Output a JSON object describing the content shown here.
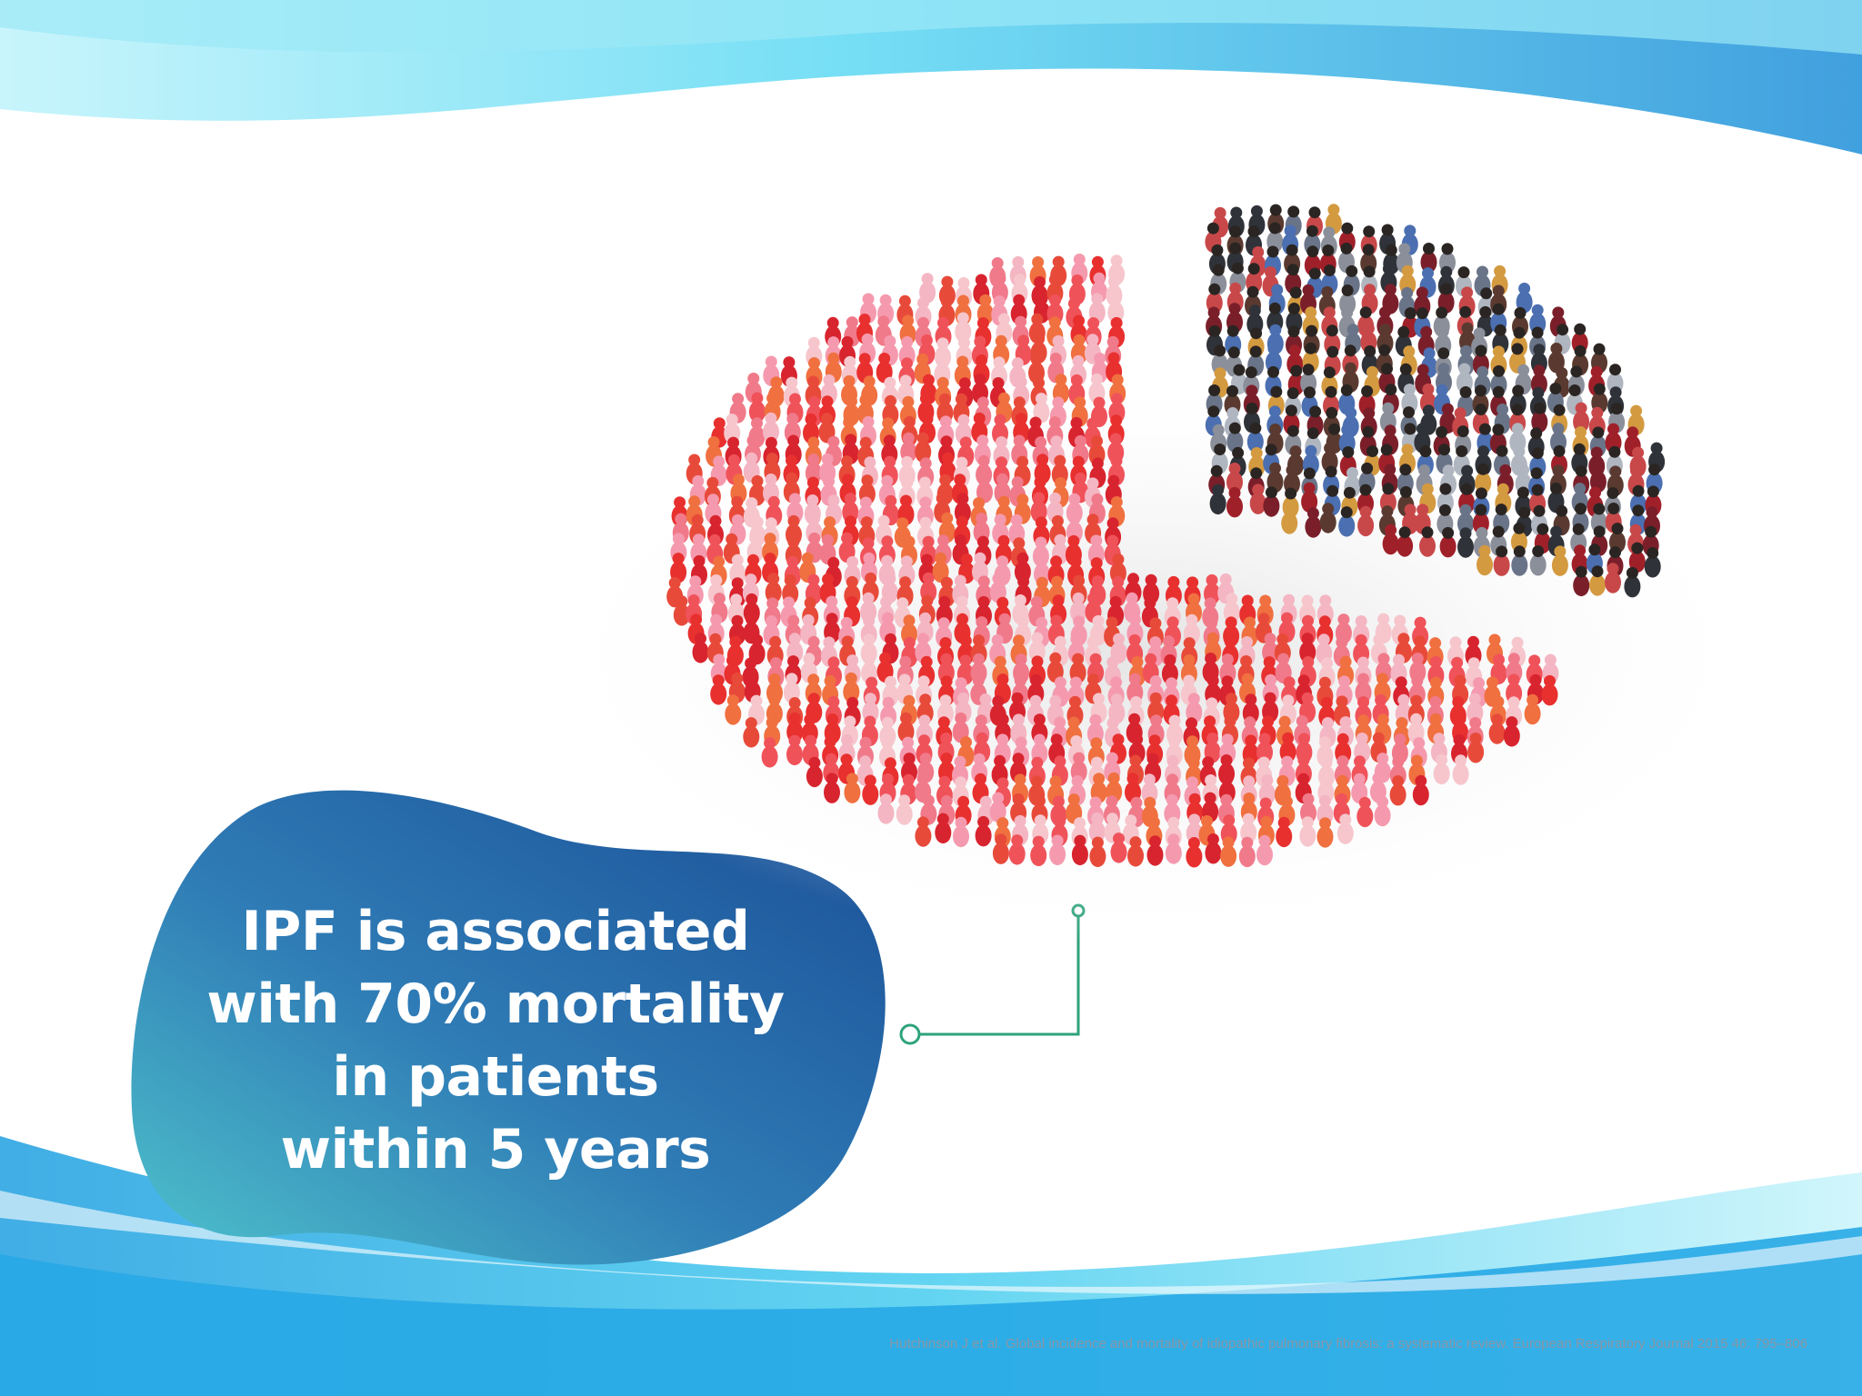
{
  "colors": {
    "wave_cyan": "#3fd0f0",
    "wave_blue": "#1f8fd8",
    "blob_dark": "#1a4e96",
    "blob_light": "#3fb6c6",
    "connector": "#2ea37a",
    "red_people": [
      "#e8302f",
      "#f0525a",
      "#f07a8a",
      "#f59aae",
      "#f4b6c2",
      "#e84a3a",
      "#f07040",
      "#d8242e",
      "#f6c6cc"
    ],
    "mixed_people": [
      "#2f3238",
      "#6a7488",
      "#8b8f9a",
      "#4b6fb0",
      "#7a1f2a",
      "#c8484a",
      "#d49a40",
      "#b0b6c0",
      "#5a3a30",
      "#a0202a"
    ]
  },
  "callout": {
    "lines": [
      "IPF is associated",
      "with 70% mortality",
      "in patients",
      "within 5 years"
    ]
  },
  "citation": "Hutchinson J et al. Global incidence and mortality of idiopathic pulmonary fibrosis: a systematic review. European Respiratory Journal 2015 46: 795–806",
  "chart_data": {
    "type": "pie",
    "categories": [
      "",
      ""
    ],
    "values": [
      70,
      30
    ],
    "title": "",
    "legend": "none"
  },
  "icons": {
    "slice_fill": "crowd-of-people-icon"
  }
}
